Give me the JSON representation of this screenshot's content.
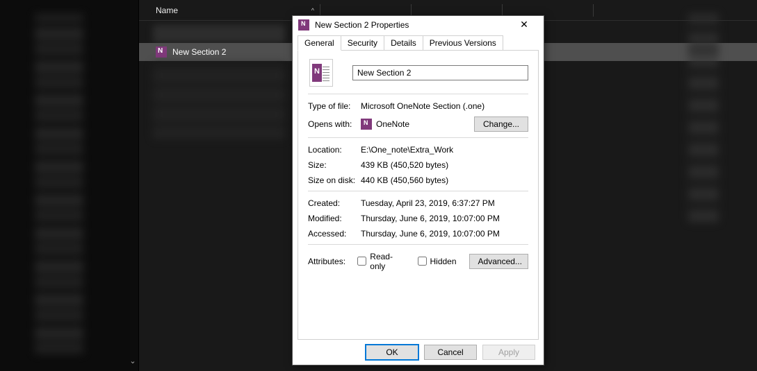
{
  "explorer": {
    "columns": {
      "name": "Name"
    },
    "selected_file": "New Section 2"
  },
  "dialog": {
    "title": "New Section 2 Properties",
    "tabs": [
      "General",
      "Security",
      "Details",
      "Previous Versions"
    ],
    "filename": "New Section 2",
    "type_label": "Type of file:",
    "type_value": "Microsoft OneNote Section (.one)",
    "opens_label": "Opens with:",
    "opens_value": "OneNote",
    "change_btn": "Change...",
    "location_label": "Location:",
    "location_value": "E:\\One_note\\Extra_Work",
    "size_label": "Size:",
    "size_value": "439 KB (450,520 bytes)",
    "disk_label": "Size on disk:",
    "disk_value": "440 KB (450,560 bytes)",
    "created_label": "Created:",
    "created_value": "Tuesday, April 23, 2019, 6:37:27 PM",
    "modified_label": "Modified:",
    "modified_value": "Thursday, June 6, 2019, 10:07:00 PM",
    "accessed_label": "Accessed:",
    "accessed_value": "Thursday, June 6, 2019, 10:07:00 PM",
    "attributes_label": "Attributes:",
    "readonly_label": "Read-only",
    "hidden_label": "Hidden",
    "advanced_btn": "Advanced...",
    "ok_btn": "OK",
    "cancel_btn": "Cancel",
    "apply_btn": "Apply"
  }
}
